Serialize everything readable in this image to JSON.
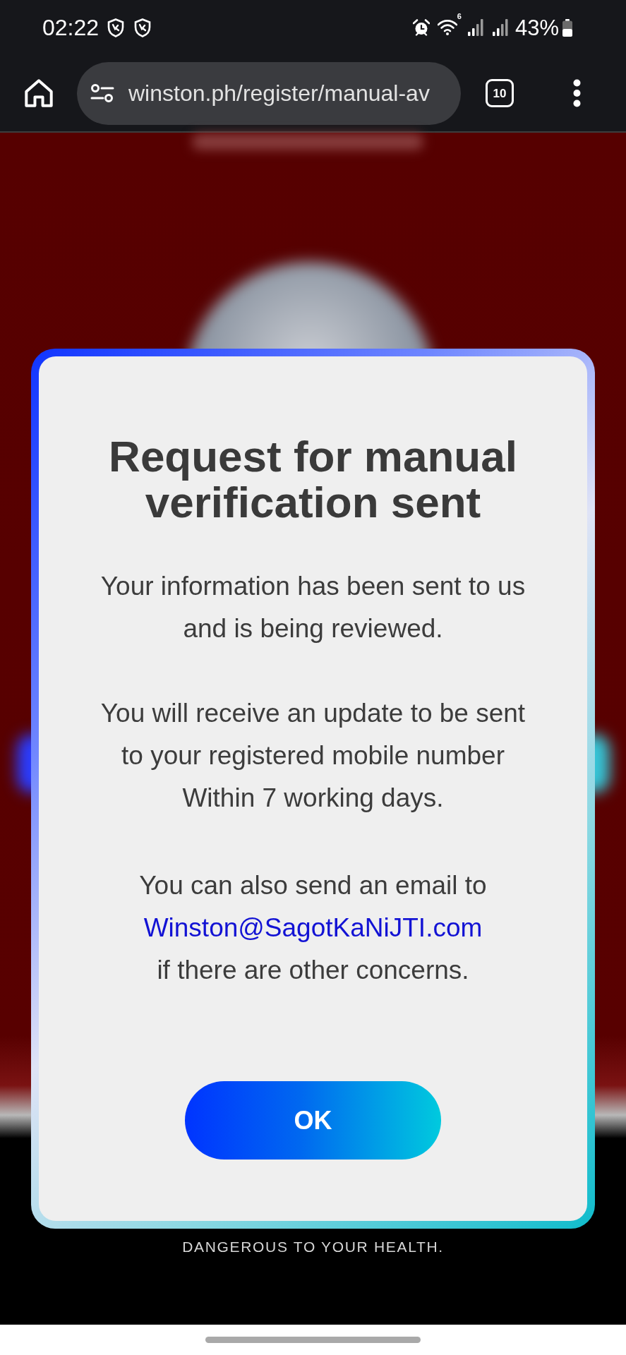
{
  "status_bar": {
    "time": "02:22",
    "wifi_badge": "6",
    "battery": "43%"
  },
  "browser_bar": {
    "url": "winston.ph/register/manual-av",
    "tab_count": "10"
  },
  "page": {
    "warning": "DANGEROUS TO YOUR HEALTH."
  },
  "dialog": {
    "title": "Request for manual verification sent",
    "paragraphs": [
      {
        "lines": [
          "Your information has been sent to us",
          "and is being reviewed."
        ]
      },
      {
        "lines": [
          "You will receive an update to be sent",
          "to your registered mobile number",
          "Within 7 working days."
        ]
      }
    ],
    "contact": {
      "before": "You can also send an email to",
      "email": "Winston@SagotKaNiJTI.com",
      "after": "if there are other concerns."
    },
    "button": "OK"
  }
}
